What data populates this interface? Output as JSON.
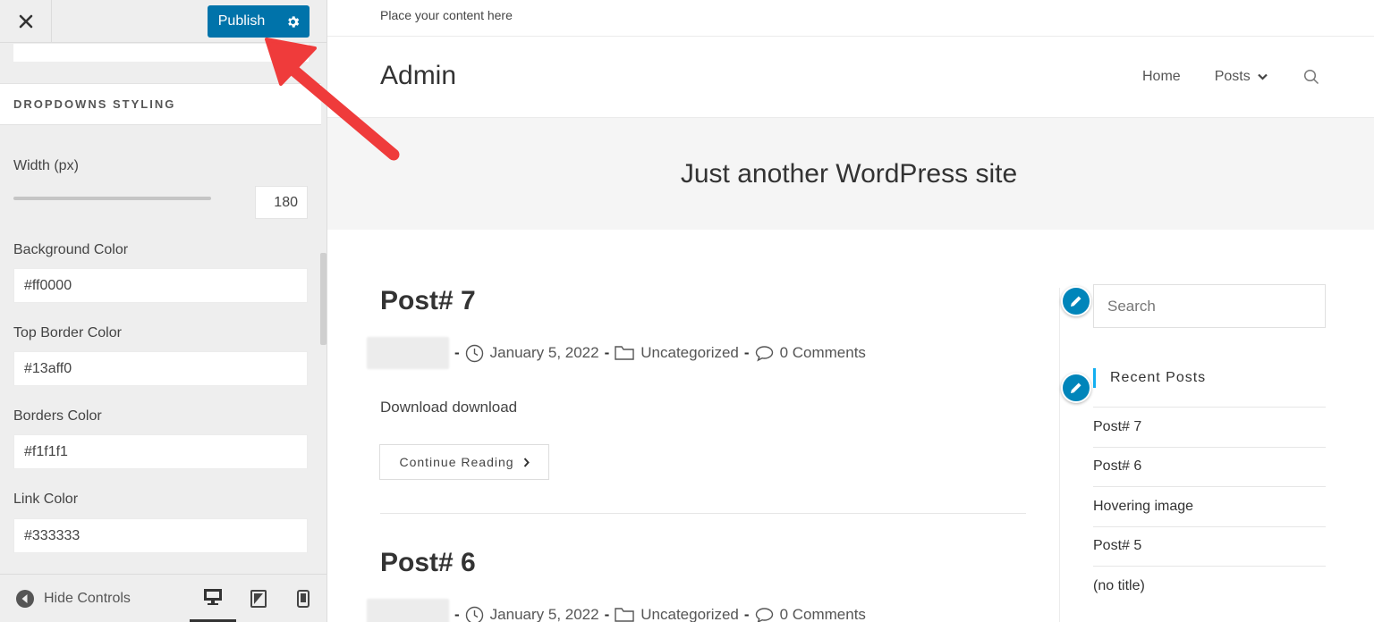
{
  "customizer": {
    "publish_label": "Publish",
    "section_title": "DROPDOWNS STYLING",
    "width": {
      "label": "Width (px)",
      "value": "180"
    },
    "fields": [
      {
        "label": "Background Color",
        "value": "#ff0000"
      },
      {
        "label": "Top Border Color",
        "value": "#13aff0"
      },
      {
        "label": "Borders Color",
        "value": "#f1f1f1"
      },
      {
        "label": "Link Color",
        "value": "#333333"
      }
    ],
    "footer": {
      "hide_controls": "Hide Controls"
    }
  },
  "preview": {
    "top_message": "Place your content here",
    "site_title": "Admin",
    "nav": {
      "home": "Home",
      "posts": "Posts"
    },
    "tagline": "Just another WordPress site",
    "posts": [
      {
        "title": "Post# 7",
        "date": "January 5, 2022",
        "category": "Uncategorized",
        "comments": "0 Comments",
        "excerpt": "Download download",
        "continue": "Continue Reading"
      },
      {
        "title": "Post# 6",
        "date": "January 5, 2022",
        "category": "Uncategorized",
        "comments": "0 Comments"
      }
    ],
    "sidebar": {
      "search_placeholder": "Search",
      "recent_title": "Recent Posts",
      "recent_posts": [
        "Post# 7",
        "Post# 6",
        "Hovering image",
        "Post# 5",
        "(no title)"
      ]
    }
  },
  "colors": {
    "primary_button": "#0073aa",
    "accent": "#13aff0",
    "edit_badge": "#0085ba",
    "annotation_arrow": "#ef3b3b"
  }
}
